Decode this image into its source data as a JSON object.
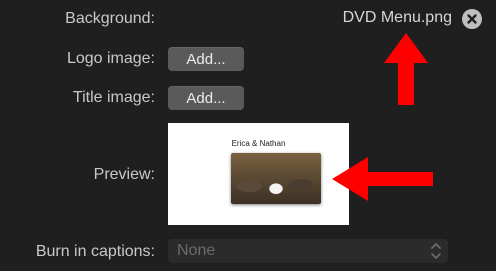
{
  "background": {
    "label": "Background:",
    "filename": "DVD Menu.png",
    "clear_icon": "x-circle-icon"
  },
  "logo_image": {
    "label": "Logo image:",
    "button": "Add..."
  },
  "title_image": {
    "label": "Title image:",
    "button": "Add..."
  },
  "preview": {
    "label": "Preview:",
    "title_text": "Erica & Nathan"
  },
  "captions": {
    "label": "Burn in captions:",
    "value": "None"
  },
  "colors": {
    "annotation_arrow": "#ff0000",
    "panel_bg": "#1f1f1f"
  }
}
